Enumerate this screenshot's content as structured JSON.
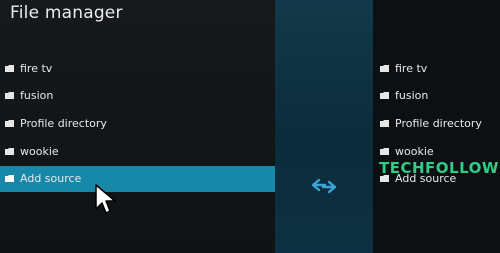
{
  "window": {
    "title": "File manager"
  },
  "left_list": {
    "items": [
      {
        "label": "fire tv",
        "icon": "folder-icon"
      },
      {
        "label": "fusion",
        "icon": "folder-icon"
      },
      {
        "label": "Profile directory",
        "icon": "folder-icon"
      },
      {
        "label": "wookie",
        "icon": "folder-icon"
      },
      {
        "label": "Add source",
        "icon": "folder-icon"
      }
    ],
    "selected_index": 4
  },
  "right_list": {
    "items": [
      {
        "label": "fire tv",
        "icon": "folder-icon"
      },
      {
        "label": "fusion",
        "icon": "folder-icon"
      },
      {
        "label": "Profile directory",
        "icon": "folder-icon"
      },
      {
        "label": "wookie",
        "icon": "folder-icon"
      },
      {
        "label": "Add source",
        "icon": "folder-icon"
      }
    ]
  },
  "divider": {
    "icon": "swap-arrows-icon"
  },
  "watermark": {
    "text": "TECHFOLLOWS"
  },
  "colors": {
    "accent": "#1788a8",
    "watermark": "#2fcd86"
  }
}
